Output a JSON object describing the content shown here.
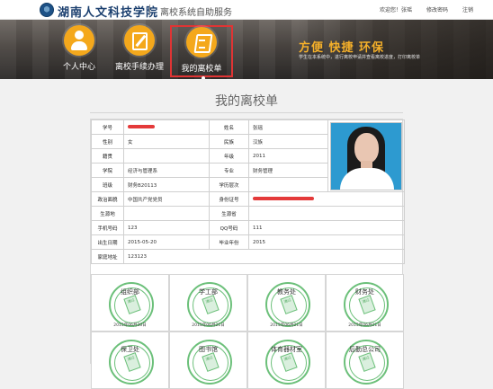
{
  "header": {
    "school_name": "湖南人文科技学院",
    "system_title": "离校系统自助服务",
    "links": [
      "欢迎您！张瑶",
      "修改密码",
      "注销"
    ]
  },
  "nav": [
    {
      "label": "个人中心",
      "icon": "person-icon",
      "active": false
    },
    {
      "label": "离校手续办理",
      "icon": "edit-form-icon",
      "active": false
    },
    {
      "label": "我的离校单",
      "icon": "document-icon",
      "active": true
    }
  ],
  "banner": {
    "slogan": "方便  快捷  环保",
    "subtitle": "学生在本系统中，进行离校申请并查看离校进度，打印离校单"
  },
  "page": {
    "title": "我的离校单"
  },
  "student": {
    "student_id_label": "学号",
    "name_label": "姓名",
    "name": "张瑶",
    "gender_label": "性别",
    "gender": "女",
    "ethnicity_label": "民族",
    "ethnicity": "汉族",
    "native_place_label": "籍贯",
    "native_place": "",
    "grade_label": "年级",
    "grade": "2011",
    "college_label": "学院",
    "college": "经济与管理系",
    "major_label": "专业",
    "major": "财务管理",
    "class_label": "班级",
    "class": "财务B20113",
    "degree_level_label": "学历层次",
    "degree_level": "",
    "political_label": "政治面貌",
    "political": "中国共产党党员",
    "id_card_label": "身份证号",
    "birthplace_label": "生源地",
    "birthplace": "",
    "hometown_label": "生源省",
    "hometown": "",
    "phone_label": "手机号码",
    "phone": "123",
    "qq_label": "QQ号码",
    "qq": "111",
    "birth_date_label": "出生日期",
    "birth_date": "2015-05-20",
    "graduation_year_label": "毕业年份",
    "graduation_year": "2015",
    "address_label": "家庭地址",
    "address": "123123"
  },
  "departments": [
    {
      "name": "组织部",
      "date": "2015年06月30日"
    },
    {
      "name": "学工部",
      "date": "2015年06月21日"
    },
    {
      "name": "教务处",
      "date": "2015年06月21日"
    },
    {
      "name": "财务处",
      "date": "2015年06月21日"
    },
    {
      "name": "保卫处",
      "date": ""
    },
    {
      "name": "图书馆",
      "date": ""
    },
    {
      "name": "体育器材室",
      "date": ""
    },
    {
      "name": "后勤总公司",
      "date": ""
    }
  ],
  "stamp_text": "通过",
  "colors": {
    "accent_orange": "#f4a81c",
    "stamp_green": "#6cc07a",
    "redaction_red": "#e43a3a",
    "active_border_red": "#e03434",
    "header_navy": "#1a3e6e"
  }
}
